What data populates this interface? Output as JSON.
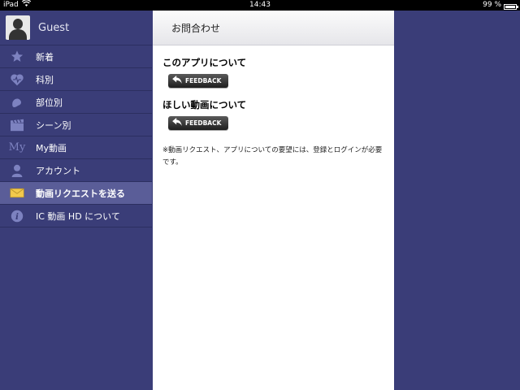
{
  "status_bar": {
    "device": "iPad",
    "time": "14:43",
    "battery": "99 %",
    "battery_level": 0.99
  },
  "sidebar": {
    "user_name": "Guest",
    "items": [
      {
        "label": "新着",
        "icon": "star-icon"
      },
      {
        "label": "科別",
        "icon": "heart-icon"
      },
      {
        "label": "部位別",
        "icon": "body-part-icon"
      },
      {
        "label": "シーン別",
        "icon": "clapperboard-icon"
      },
      {
        "label": "My動画",
        "icon": "my-icon",
        "icon_text": "My"
      },
      {
        "label": "アカウント",
        "icon": "person-icon"
      },
      {
        "label": "動画リクエストを送る",
        "icon": "envelope-icon",
        "active": true
      },
      {
        "label": "IC 動画 HD について",
        "icon": "info-icon"
      }
    ]
  },
  "main": {
    "title": "お問合わせ",
    "sections": [
      {
        "title": "このアプリについて",
        "button": "FEEDBACK"
      },
      {
        "title": "ほしい動画について",
        "button": "FEEDBACK"
      }
    ],
    "note": "※動画リクエスト、アプリについての要望には、登録とログインが必要です。"
  },
  "colors": {
    "background": "#3a3d78",
    "active_item": "#5a5d98",
    "icon": "#8a8ec8"
  }
}
